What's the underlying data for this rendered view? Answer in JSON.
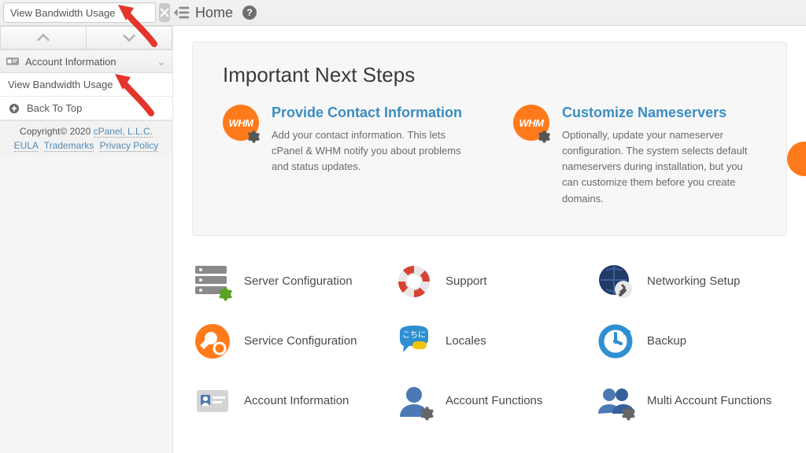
{
  "search": {
    "value": "View Bandwidth Usage"
  },
  "breadcrumb": {
    "label": "Home",
    "help": "?"
  },
  "sidebar": {
    "group": {
      "label": "Account Information",
      "chev": "⌄"
    },
    "items": [
      {
        "label": "View Bandwidth Usage"
      }
    ],
    "back_label": "Back To Top"
  },
  "footer": {
    "copyright_prefix": "Copyright© 2020 ",
    "company": "cPanel, L.L.C.",
    "links": [
      {
        "label": "EULA"
      },
      {
        "label": "Trademarks"
      },
      {
        "label": "Privacy Policy"
      }
    ]
  },
  "card": {
    "title": "Important Next Steps",
    "steps": [
      {
        "title": "Provide Contact Information",
        "desc": "Add your contact information. This lets cPanel & WHM notify you about problems and status updates."
      },
      {
        "title": "Customize Nameservers",
        "desc": "Optionally, update your nameserver configuration. The system selects default nameservers during installation, but you can customize them before you create domains."
      }
    ]
  },
  "grid": [
    {
      "label": "Server Configuration"
    },
    {
      "label": "Support"
    },
    {
      "label": "Networking Setup"
    },
    {
      "label": "Service Configuration"
    },
    {
      "label": "Locales"
    },
    {
      "label": "Backup"
    },
    {
      "label": "Account Information"
    },
    {
      "label": "Account Functions"
    },
    {
      "label": "Multi Account Functions"
    }
  ]
}
